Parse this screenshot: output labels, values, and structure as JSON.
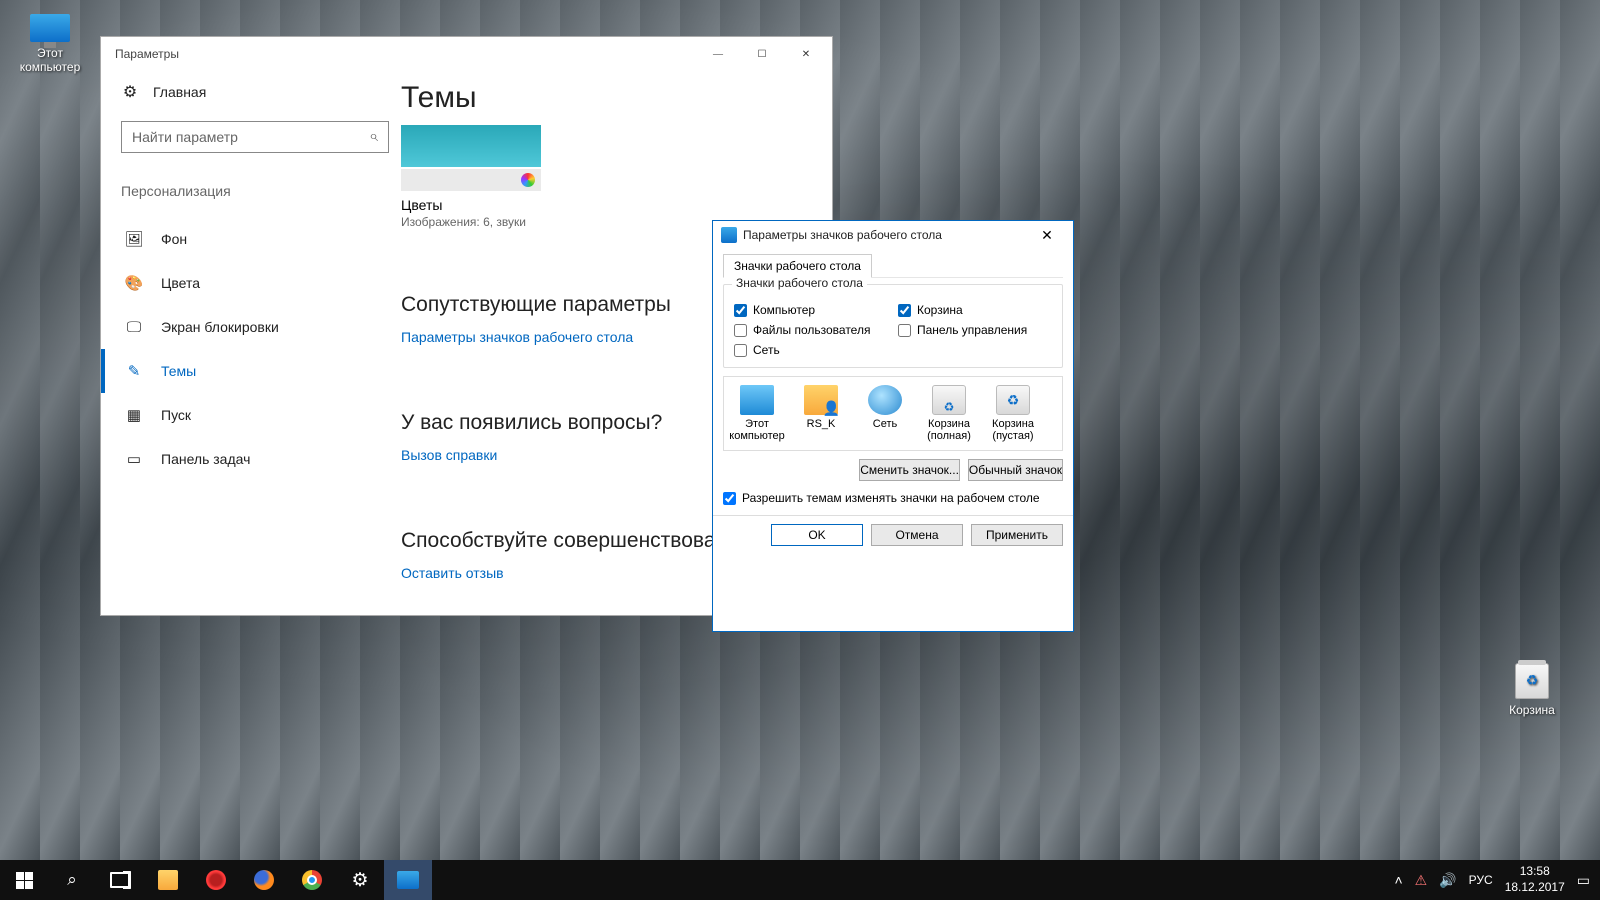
{
  "desktop_icons": {
    "computer": "Этот компьютер",
    "recycle": "Корзина"
  },
  "settings": {
    "title": "Параметры",
    "home": "Главная",
    "search_placeholder": "Найти параметр",
    "section": "Персонализация",
    "nav": {
      "background": "Фон",
      "colors": "Цвета",
      "lockscreen": "Экран блокировки",
      "themes": "Темы",
      "start": "Пуск",
      "taskbar": "Панель задач"
    },
    "content": {
      "heading": "Темы",
      "theme_name": "Цветы",
      "theme_desc": "Изображения: 6, звуки",
      "related_heading": "Сопутствующие параметры",
      "related_link": "Параметры значков рабочего стола",
      "help_heading": "У вас появились вопросы?",
      "help_link": "Вызов справки",
      "feedback_heading": "Способствуйте совершенствованию",
      "feedback_link": "Оставить отзыв"
    }
  },
  "dialog": {
    "title": "Параметры значков рабочего стола",
    "tab": "Значки рабочего стола",
    "legend": "Значки рабочего стола",
    "checks": {
      "computer": "Компьютер",
      "user_files": "Файлы пользователя",
      "network": "Сеть",
      "recycle": "Корзина",
      "control_panel": "Панель управления"
    },
    "icons": {
      "computer": "Этот компьютер",
      "user": "RS_K",
      "network": "Сеть",
      "bin_full": "Корзина (полная)",
      "bin_empty": "Корзина (пустая)"
    },
    "btn_change": "Сменить значок...",
    "btn_default": "Обычный значок",
    "allow_themes": "Разрешить темам изменять значки на рабочем столе",
    "ok": "OK",
    "cancel": "Отмена",
    "apply": "Применить"
  },
  "taskbar": {
    "lang": "РУС",
    "time": "13:58",
    "date": "18.12.2017"
  }
}
